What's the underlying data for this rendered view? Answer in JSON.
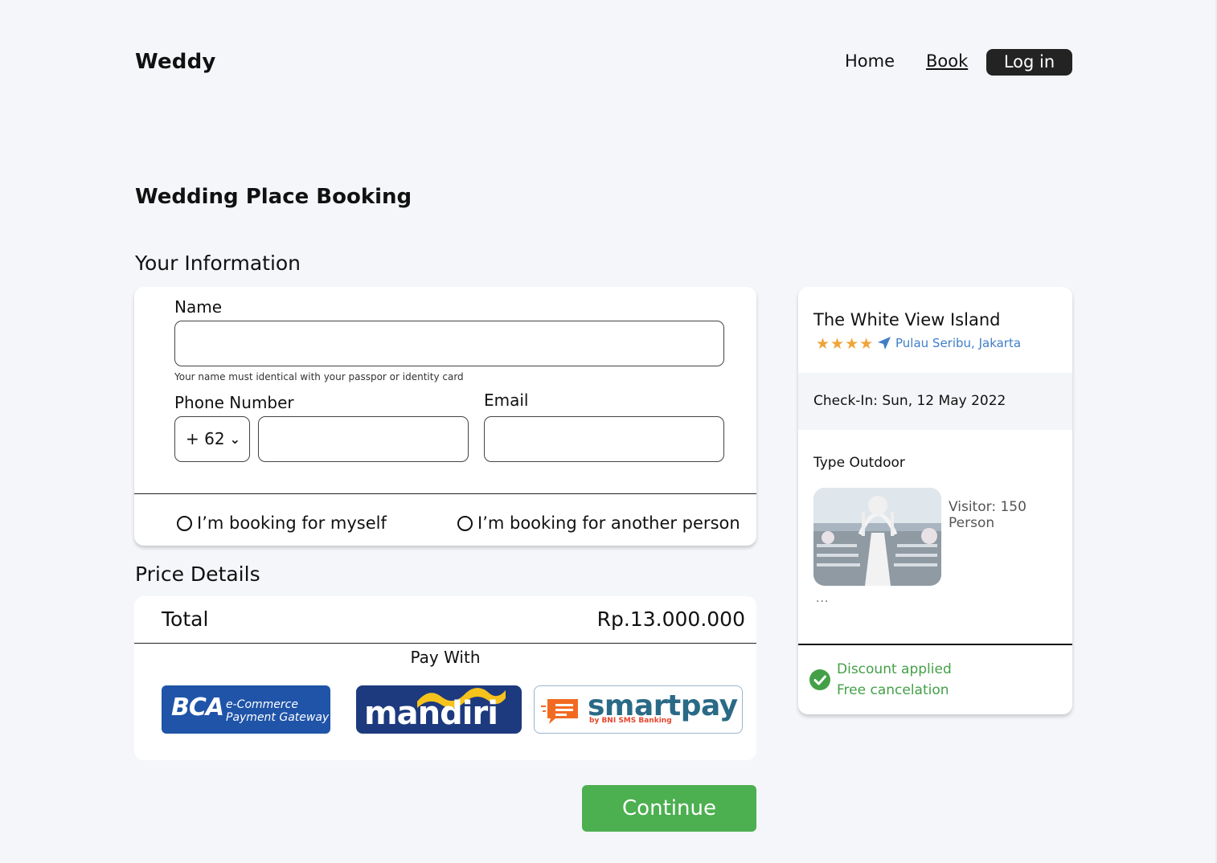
{
  "header": {
    "logo": "Weddy",
    "nav": {
      "home": "Home",
      "book": "Book",
      "login": "Log in"
    }
  },
  "page_title": "Wedding Place Booking",
  "your_information": {
    "title": "Your Information",
    "name_label": "Name",
    "name_value": "",
    "name_hint": "Your name must identical with your passpor or identity card",
    "phone_label": "Phone Number",
    "country_code": "+ 62",
    "phone_value": "",
    "email_label": "Email",
    "email_value": "",
    "booking_for": [
      {
        "label": "I’m booking for myself",
        "selected": false
      },
      {
        "label": "I’m booking for another person",
        "selected": false
      }
    ]
  },
  "price_details": {
    "title": "Price Details",
    "total_label": "Total",
    "total_value": "Rp.13.000.000",
    "pay_with": "Pay With",
    "methods": {
      "bca": {
        "brand": "BCA",
        "line1": "e-Commerce",
        "line2": "Payment Gateway"
      },
      "mandiri": {
        "brand": "mandiri"
      },
      "smartpay": {
        "brand": "smartpay",
        "sub": "by BNI SMS Banking"
      }
    }
  },
  "continue_label": "Continue",
  "venue": {
    "name": "The White View Island",
    "rating": 4,
    "location": "Pulau Seribu, Jakarta",
    "checkin": "Check-In: Sun, 12 May 2022",
    "type": "Type Outdoor",
    "visitor": "Visitor: 150 Person",
    "more": "...",
    "discount": "Discount applied",
    "cancelation": "Free cancelation"
  },
  "colors": {
    "background": "#f4f6fa",
    "accent_green": "#4caf50",
    "link_blue": "#3f7ec8",
    "star": "#f0a43a",
    "login_bg": "#232323"
  }
}
